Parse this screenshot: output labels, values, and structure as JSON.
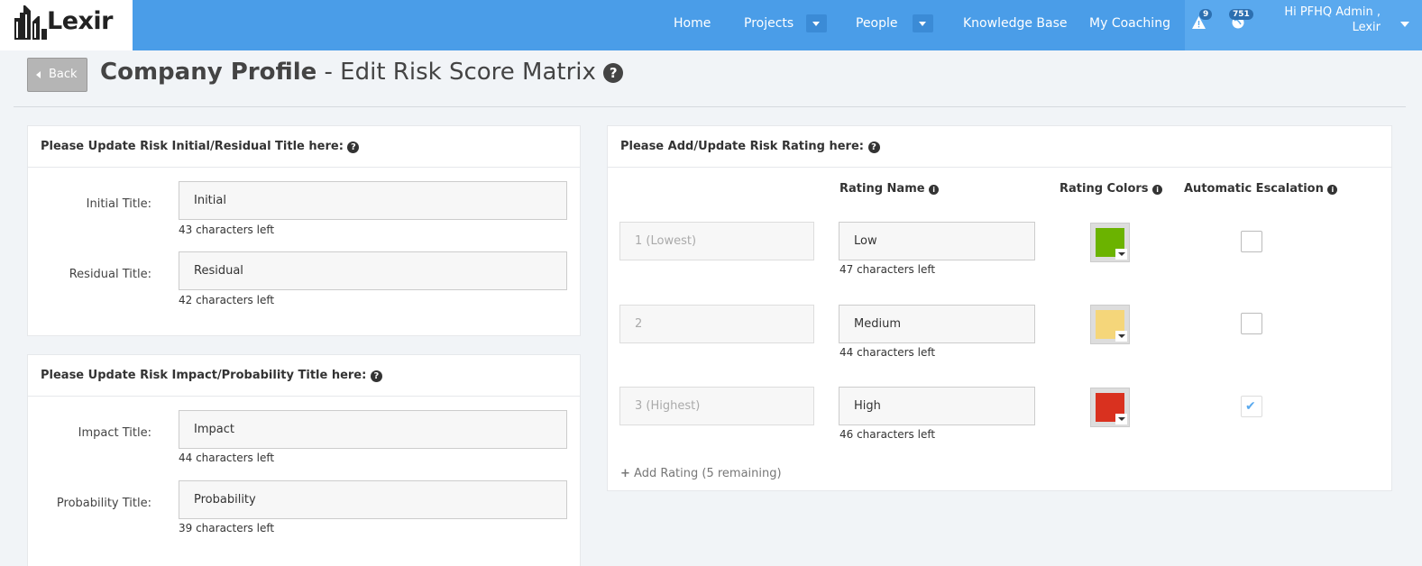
{
  "nav": {
    "logo_text": "Lexir",
    "items": [
      {
        "label": "Home"
      },
      {
        "label": "Projects"
      },
      {
        "label": "People"
      },
      {
        "label": "Knowledge Base"
      },
      {
        "label": "My Coaching"
      }
    ],
    "alerts_count": "9",
    "notifications_count": "751",
    "user_greeting_line1": "Hi PFHQ Admin ,",
    "user_greeting_line2": "Lexir"
  },
  "header": {
    "back_label": "Back",
    "title_bold": "Company Profile",
    "title_rest": " - Edit Risk Score Matrix"
  },
  "initial_residual": {
    "heading": "Please Update Risk Initial/Residual Title here: ",
    "fields": [
      {
        "label": "Initial Title:",
        "value": "Initial",
        "chars_left": "43 characters left"
      },
      {
        "label": "Residual Title:",
        "value": "Residual",
        "chars_left": "42 characters left"
      }
    ]
  },
  "impact_probability": {
    "heading": "Please Update Risk Impact/Probability Title here: ",
    "fields": [
      {
        "label": "Impact Title:",
        "value": "Impact",
        "chars_left": "44 characters left"
      },
      {
        "label": "Probability Title:",
        "value": "Probability",
        "chars_left": "39 characters left"
      }
    ]
  },
  "ratings": {
    "heading": "Please Add/Update Risk Rating here: ",
    "columns": {
      "rating_name": "Rating Name",
      "rating_colors": "Rating Colors",
      "automatic_escalation": "Automatic Escalation"
    },
    "rows": [
      {
        "level": "1 (Lowest)",
        "name": "Low",
        "chars_left": "47 characters left",
        "color": "#6bb300",
        "escalation": false
      },
      {
        "level": "2",
        "name": "Medium",
        "chars_left": "44 characters left",
        "color": "#f5d67a",
        "escalation": false
      },
      {
        "level": "3 (Highest)",
        "name": "High",
        "chars_left": "46 characters left",
        "color": "#d9311f",
        "escalation": true
      }
    ],
    "add_label": "Add Rating (5 remaining)"
  },
  "icons": {
    "help": "question-circle-icon",
    "info": "info-circle-icon",
    "alert": "warning-triangle-icon",
    "notifications": "globe-icon",
    "plus": "plus-icon"
  },
  "colors": {
    "navbar": "#4a9de8",
    "navbar_right": "#5aa9ee",
    "page_bg": "#f1f4f7"
  }
}
